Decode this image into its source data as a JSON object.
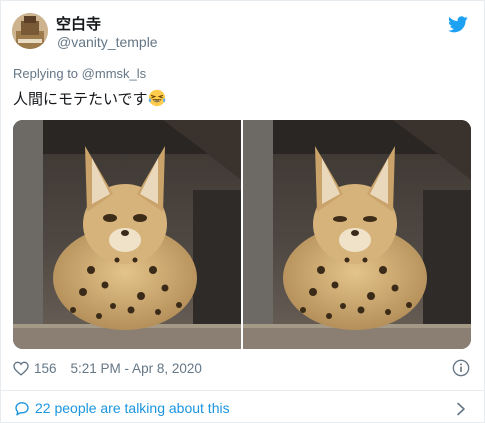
{
  "user": {
    "display_name": "空白寺",
    "handle": "@vanity_temple"
  },
  "tweet": {
    "replying_prefix": "Replying to",
    "replying_handle": "@mmsk_ls",
    "text": "人間にモテたいです",
    "emoji_icon": "laughing-tears-emoji"
  },
  "media": {
    "photos": [
      {
        "subject": "serval-cat-photo"
      },
      {
        "subject": "serval-cat-photo"
      }
    ]
  },
  "meta": {
    "likes": "156",
    "timestamp": "5:21 PM - Apr 8, 2020"
  },
  "footer": {
    "talking": "22 people are talking about this"
  },
  "colors": {
    "accent": "#1da1f2",
    "link": "#1b95e0",
    "muted": "#657786",
    "text": "#14171a",
    "border": "#e6ecf0"
  }
}
